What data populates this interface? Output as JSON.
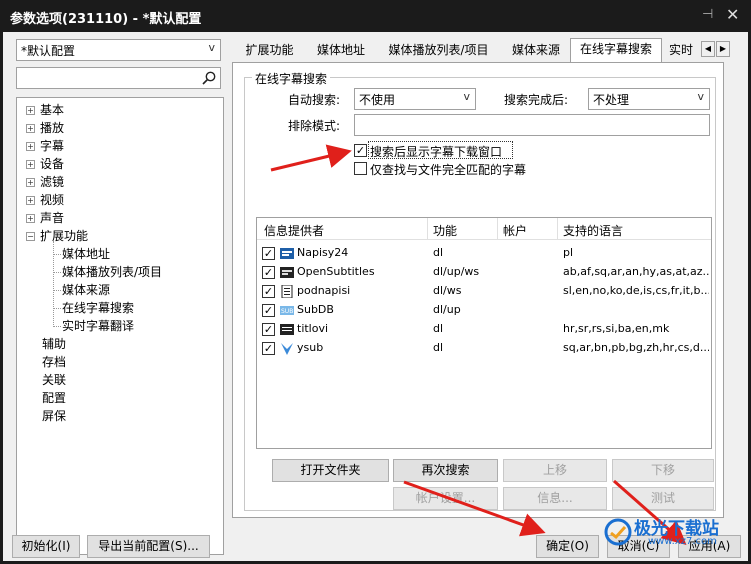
{
  "window": {
    "title": "参数选项(231110) - *默认配置",
    "pin_glyph": "⊣",
    "close_glyph": "✕"
  },
  "left": {
    "profile_combo": "*默认配置",
    "tree": [
      {
        "label": "基本",
        "level": 0,
        "expander": "+"
      },
      {
        "label": "播放",
        "level": 0,
        "expander": "+"
      },
      {
        "label": "字幕",
        "level": 0,
        "expander": "+"
      },
      {
        "label": "设备",
        "level": 0,
        "expander": "+"
      },
      {
        "label": "滤镜",
        "level": 0,
        "expander": "+"
      },
      {
        "label": "视频",
        "level": 0,
        "expander": "+"
      },
      {
        "label": "声音",
        "level": 0,
        "expander": "+"
      },
      {
        "label": "扩展功能",
        "level": 0,
        "expander": "−"
      },
      {
        "label": "媒体地址",
        "level": 1,
        "expander": ""
      },
      {
        "label": "媒体播放列表/项目",
        "level": 1,
        "expander": ""
      },
      {
        "label": "媒体来源",
        "level": 1,
        "expander": ""
      },
      {
        "label": "在线字幕搜索",
        "level": 1,
        "expander": ""
      },
      {
        "label": "实时字幕翻译",
        "level": 1,
        "expander": ""
      },
      {
        "label": "辅助",
        "level": 0,
        "expander": ""
      },
      {
        "label": "存档",
        "level": 0,
        "expander": ""
      },
      {
        "label": "关联",
        "level": 0,
        "expander": ""
      },
      {
        "label": "配置",
        "level": 0,
        "expander": ""
      },
      {
        "label": "屏保",
        "level": 0,
        "expander": ""
      }
    ]
  },
  "tabs": [
    {
      "label": "扩展功能"
    },
    {
      "label": "媒体地址"
    },
    {
      "label": "媒体播放列表/项目"
    },
    {
      "label": "媒体来源"
    },
    {
      "label": "在线字幕搜索"
    },
    {
      "label": "实时"
    }
  ],
  "tab_scroll": {
    "left": "◀",
    "right": "▶"
  },
  "group": {
    "title": "在线字幕搜索",
    "auto_search_label": "自动搜索:",
    "auto_search_value": "不使用",
    "after_search_label": "搜索完成后:",
    "after_search_value": "不处理",
    "exclude_label": "排除模式:",
    "exclude_value": "",
    "checkbox_show_window": {
      "label": "搜索后显示字幕下载窗口",
      "checked": true
    },
    "checkbox_exact_match": {
      "label": "仅查找与文件完全匹配的字幕",
      "checked": false
    }
  },
  "list": {
    "headers": [
      "信息提供者",
      "功能",
      "帐户",
      "支持的语言"
    ],
    "rows": [
      {
        "name": "Napisy24",
        "function": "dl",
        "account": "",
        "languages": "pl",
        "checked": true,
        "icon": "napisy24-icon"
      },
      {
        "name": "OpenSubtitles",
        "function": "dl/up/ws",
        "account": "",
        "languages": "ab,af,sq,ar,an,hy,as,at,az...",
        "checked": true,
        "icon": "opensubtitles-icon"
      },
      {
        "name": "podnapisi",
        "function": "dl/ws",
        "account": "",
        "languages": "sl,en,no,ko,de,is,cs,fr,it,b...",
        "checked": true,
        "icon": "podnapisi-icon"
      },
      {
        "name": "SubDB",
        "function": "dl/up",
        "account": "",
        "languages": "",
        "checked": true,
        "icon": "subdb-icon"
      },
      {
        "name": "titlovi",
        "function": "dl",
        "account": "",
        "languages": "hr,sr,rs,si,ba,en,mk",
        "checked": true,
        "icon": "titlovi-icon"
      },
      {
        "name": "ysub",
        "function": "dl",
        "account": "",
        "languages": "sq,ar,bn,pb,bg,zh,hr,cs,d...",
        "checked": true,
        "icon": "ysub-icon"
      }
    ]
  },
  "buttons": {
    "open_folder": "打开文件夹",
    "search_again": "再次搜索",
    "move_up": "上移",
    "move_down": "下移",
    "account_settings": "帐户设置...",
    "info": "信息...",
    "test": "测试",
    "initialize": "初始化(I)",
    "export_config": "导出当前配置(S)...",
    "ok": "确定(O)",
    "cancel": "取消(C)",
    "apply": "应用(A)"
  },
  "check_glyph": "✓",
  "watermark": {
    "text": "极光下载站",
    "url": "www.xz7.com"
  },
  "colors": {
    "annotation_arrow": "#e0201b",
    "watermark": "#1a6fd1"
  }
}
